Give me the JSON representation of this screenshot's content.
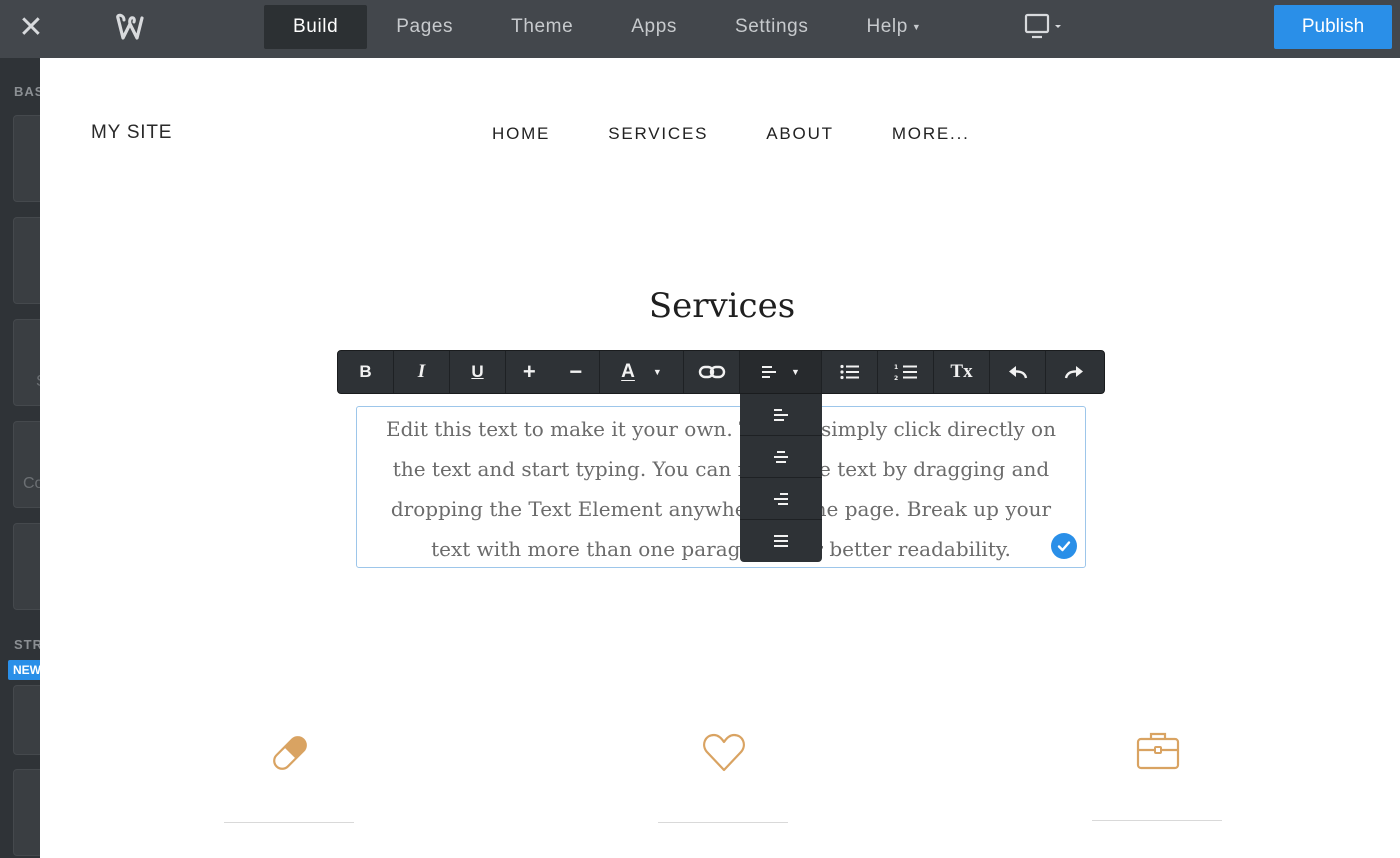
{
  "topbar": {
    "close_icon": "close-icon",
    "logo_icon": "weebly-logo-icon",
    "tabs": [
      {
        "label": "Build",
        "active": true
      },
      {
        "label": "Pages"
      },
      {
        "label": "Theme"
      },
      {
        "label": "Apps"
      },
      {
        "label": "Settings"
      },
      {
        "label": "Help",
        "dropdown": true
      }
    ],
    "device_icon": "desktop-icon",
    "publish_label": "Publish",
    "accent_color": "#2a8fe8"
  },
  "sidebar": {
    "section_basic": "BAS",
    "section_structure": "STR",
    "new_badge": "NEW",
    "tile_fragments": [
      "S",
      "Co"
    ]
  },
  "site": {
    "title": "MY SITE",
    "nav": [
      "HOME",
      "SERVICES",
      "ABOUT",
      "MORE..."
    ]
  },
  "main": {
    "heading": "Services",
    "text_element": {
      "lines": [
        "Edit this text to make it your own. To edit, simply click directly on",
        "the text and start typing. You can move the text by dragging and",
        "dropping the Text Element anywhere on the page. Break up your",
        "text with more than one paragraph for better readability."
      ]
    },
    "features": [
      "pill-icon",
      "heart-icon",
      "briefcase-icon"
    ],
    "feature_color": "#d9a362"
  },
  "toolbar": {
    "buttons": [
      {
        "name": "bold-button",
        "label": "B"
      },
      {
        "name": "italic-button",
        "label": "I"
      },
      {
        "name": "underline-button",
        "label": "U"
      },
      {
        "name": "increase-font-button",
        "label": "+"
      },
      {
        "name": "decrease-font-button",
        "label": "−"
      },
      {
        "name": "text-color-button",
        "label": "A"
      },
      {
        "name": "link-button",
        "icon": "link-icon"
      },
      {
        "name": "align-button",
        "icon": "align-left-icon"
      },
      {
        "name": "bullet-list-button",
        "icon": "bullet-list-icon"
      },
      {
        "name": "numbered-list-button",
        "icon": "numbered-list-icon"
      },
      {
        "name": "clear-format-button",
        "label": "Tx"
      },
      {
        "name": "undo-button",
        "icon": "undo-icon"
      },
      {
        "name": "redo-button",
        "icon": "redo-icon"
      }
    ],
    "align_options": [
      "align-left-icon",
      "align-center-icon",
      "align-right-icon",
      "align-justify-icon"
    ]
  }
}
